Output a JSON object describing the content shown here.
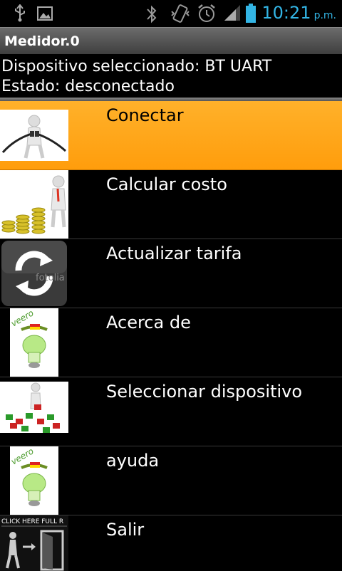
{
  "status_bar": {
    "time": "10:21",
    "ampm": "p.m.",
    "icons": [
      "usb-icon",
      "image-icon",
      "bluetooth-icon",
      "vibrate-icon",
      "alarm-icon",
      "signal-icon",
      "battery-icon"
    ],
    "accent_color": "#33b5e5"
  },
  "app": {
    "title": "Medidor.0"
  },
  "info": {
    "device_line": "Dispositivo seleccionado: BT UART",
    "status_line": "Estado: desconectado"
  },
  "menu": {
    "items": [
      {
        "label": "Conectar",
        "icon": "plug-person-icon",
        "selected": true
      },
      {
        "label": "Calcular costo",
        "icon": "coins-person-icon",
        "selected": false
      },
      {
        "label": "Actualizar tarifa",
        "icon": "refresh-icon",
        "selected": false
      },
      {
        "label": "Acerca de",
        "icon": "bulb-logo-icon",
        "selected": false
      },
      {
        "label": "Seleccionar dispositivo",
        "icon": "puzzle-person-icon",
        "selected": false
      },
      {
        "label": "ayuda",
        "icon": "bulb-logo-icon",
        "selected": false
      },
      {
        "label": "Salir",
        "icon": "exit-door-icon",
        "selected": false
      }
    ],
    "selected_color": "#ffa81d"
  },
  "thumb_text": {
    "refresh_watermark": "fotolia",
    "bulb_brand": "veero",
    "exit_banner": "CLICK HERE  FULL R"
  }
}
